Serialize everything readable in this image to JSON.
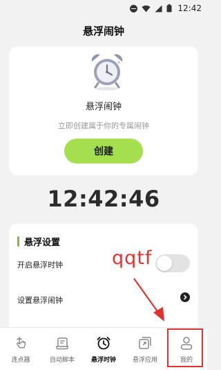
{
  "status_bar": {
    "time": "12:42",
    "icons": [
      "dnd-icon",
      "wifi-icon",
      "signal-icon",
      "battery-icon"
    ]
  },
  "page": {
    "title": "悬浮闹钟"
  },
  "create_card": {
    "illustration": "alarm-clock-icon",
    "title": "悬浮闹钟",
    "subtitle": "立即创建属于你的专属闹钟",
    "button_label": "创建"
  },
  "current_time": "12:42:46",
  "settings": {
    "title": "悬浮设置",
    "rows": [
      {
        "label": "开启悬浮时钟",
        "control": "toggle",
        "value": "off"
      },
      {
        "label": "设置悬浮闹钟",
        "control": "chevron"
      }
    ]
  },
  "annotation": {
    "text": "qqtf"
  },
  "bottom_nav": {
    "items": [
      {
        "label": "连点器",
        "icon": "tap-icon"
      },
      {
        "label": "自动脚本",
        "icon": "script-icon"
      },
      {
        "label": "悬浮时钟",
        "icon": "clock-icon",
        "active": true
      },
      {
        "label": "悬浮应用",
        "icon": "floating-app-icon"
      },
      {
        "label": "我的",
        "icon": "person-icon"
      }
    ]
  },
  "colors": {
    "accent_green": "#a4df4d",
    "settings_bar": "#7bc043",
    "annotation_red": "#e0322e",
    "background": "#f2f2f2"
  }
}
